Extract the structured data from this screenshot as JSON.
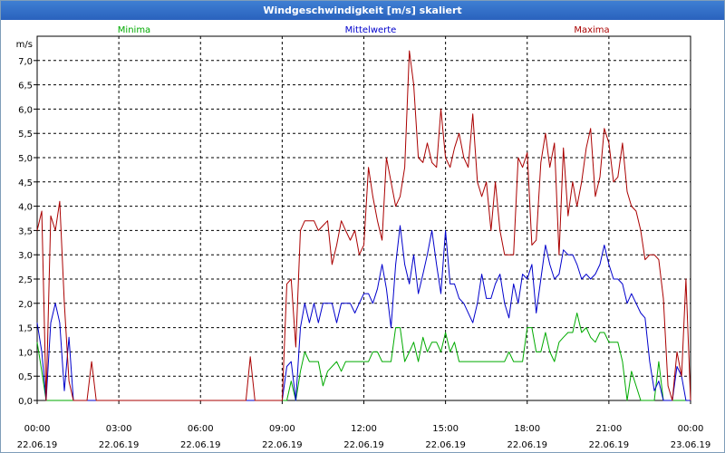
{
  "window": {
    "title": "Windgeschwindigkeit [m/s] skaliert"
  },
  "chart_data": {
    "type": "line",
    "title": "Windgeschwindigkeit [m/s] skaliert",
    "ylabel": "m/s",
    "ylim": [
      0,
      7.5
    ],
    "xlim": [
      0,
      24
    ],
    "grid": true,
    "legend_position": "top",
    "y_ticks": [
      "0,0",
      "0,5",
      "1,0",
      "1,5",
      "2,0",
      "2,5",
      "3,0",
      "3,5",
      "4,0",
      "4,5",
      "5,0",
      "5,5",
      "6,0",
      "6,5",
      "7,0"
    ],
    "x_ticks": [
      {
        "time": "00:00",
        "date": "22.06.19"
      },
      {
        "time": "03:00",
        "date": "22.06.19"
      },
      {
        "time": "06:00",
        "date": "22.06.19"
      },
      {
        "time": "09:00",
        "date": "22.06.19"
      },
      {
        "time": "12:00",
        "date": "22.06.19"
      },
      {
        "time": "15:00",
        "date": "22.06.19"
      },
      {
        "time": "18:00",
        "date": "22.06.19"
      },
      {
        "time": "21:00",
        "date": "22.06.19"
      },
      {
        "time": "00:00",
        "date": "23.06.19"
      }
    ],
    "series": [
      {
        "name": "Minima",
        "color": "#00aa00",
        "points": [
          [
            0,
            1.2
          ],
          [
            0.17,
            0.6
          ],
          [
            0.33,
            0
          ],
          [
            0.5,
            0
          ],
          [
            0.67,
            0
          ],
          [
            0.83,
            0
          ],
          [
            1,
            0
          ],
          [
            1.17,
            0
          ],
          [
            1.33,
            0
          ],
          [
            1.5,
            0
          ],
          [
            2,
            0
          ],
          [
            3,
            0
          ],
          [
            6,
            0
          ],
          [
            8,
            0
          ],
          [
            9,
            0
          ],
          [
            9.17,
            0
          ],
          [
            9.33,
            0.4
          ],
          [
            9.5,
            0
          ],
          [
            9.67,
            0.6
          ],
          [
            9.83,
            1
          ],
          [
            10,
            0.8
          ],
          [
            10.17,
            0.8
          ],
          [
            10.33,
            0.8
          ],
          [
            10.5,
            0.3
          ],
          [
            10.67,
            0.6
          ],
          [
            10.83,
            0.7
          ],
          [
            11,
            0.8
          ],
          [
            11.17,
            0.6
          ],
          [
            11.33,
            0.8
          ],
          [
            11.5,
            0.8
          ],
          [
            11.67,
            0.8
          ],
          [
            11.83,
            0.8
          ],
          [
            12,
            0.8
          ],
          [
            12.17,
            0.8
          ],
          [
            12.33,
            1
          ],
          [
            12.5,
            1
          ],
          [
            12.67,
            0.8
          ],
          [
            12.83,
            0.8
          ],
          [
            13,
            0.8
          ],
          [
            13.17,
            1.5
          ],
          [
            13.33,
            1.5
          ],
          [
            13.5,
            0.8
          ],
          [
            13.67,
            1
          ],
          [
            13.83,
            1.2
          ],
          [
            14,
            0.8
          ],
          [
            14.17,
            1.3
          ],
          [
            14.33,
            1
          ],
          [
            14.5,
            1.2
          ],
          [
            14.67,
            1.2
          ],
          [
            14.83,
            1
          ],
          [
            15,
            1.4
          ],
          [
            15.17,
            1
          ],
          [
            15.33,
            1.2
          ],
          [
            15.5,
            0.8
          ],
          [
            15.67,
            0.8
          ],
          [
            16,
            0.8
          ],
          [
            16.5,
            0.8
          ],
          [
            17,
            0.8
          ],
          [
            17.17,
            0.8
          ],
          [
            17.33,
            1
          ],
          [
            17.5,
            0.8
          ],
          [
            17.67,
            0.8
          ],
          [
            17.83,
            0.8
          ],
          [
            18,
            1.5
          ],
          [
            18.17,
            1.5
          ],
          [
            18.33,
            1
          ],
          [
            18.5,
            1
          ],
          [
            18.67,
            1.4
          ],
          [
            18.83,
            1
          ],
          [
            19,
            0.8
          ],
          [
            19.17,
            1.2
          ],
          [
            19.33,
            1.3
          ],
          [
            19.5,
            1.4
          ],
          [
            19.67,
            1.4
          ],
          [
            19.83,
            1.8
          ],
          [
            20,
            1.4
          ],
          [
            20.17,
            1.5
          ],
          [
            20.33,
            1.3
          ],
          [
            20.5,
            1.2
          ],
          [
            20.67,
            1.4
          ],
          [
            20.83,
            1.4
          ],
          [
            21,
            1.2
          ],
          [
            21.17,
            1.2
          ],
          [
            21.33,
            1.2
          ],
          [
            21.5,
            0.8
          ],
          [
            21.67,
            0
          ],
          [
            21.83,
            0.6
          ],
          [
            22,
            0.3
          ],
          [
            22.17,
            0
          ],
          [
            22.33,
            0
          ],
          [
            22.5,
            0
          ],
          [
            22.67,
            0
          ],
          [
            22.83,
            0.8
          ],
          [
            23,
            0
          ],
          [
            23.17,
            0
          ],
          [
            23.33,
            0
          ],
          [
            23.5,
            0
          ],
          [
            23.67,
            0
          ],
          [
            23.83,
            0
          ],
          [
            24,
            0
          ]
        ]
      },
      {
        "name": "Mittelwerte",
        "color": "#0000cc",
        "points": [
          [
            0,
            1.6
          ],
          [
            0.17,
            1
          ],
          [
            0.33,
            0
          ],
          [
            0.5,
            1.6
          ],
          [
            0.67,
            2
          ],
          [
            0.83,
            1.6
          ],
          [
            1,
            0.2
          ],
          [
            1.17,
            1.3
          ],
          [
            1.33,
            0
          ],
          [
            1.5,
            0
          ],
          [
            2,
            0
          ],
          [
            3,
            0
          ],
          [
            6,
            0
          ],
          [
            8,
            0
          ],
          [
            9,
            0
          ],
          [
            9.17,
            0.7
          ],
          [
            9.33,
            0.8
          ],
          [
            9.5,
            0
          ],
          [
            9.67,
            1.5
          ],
          [
            9.83,
            2
          ],
          [
            10,
            1.6
          ],
          [
            10.17,
            2
          ],
          [
            10.33,
            1.6
          ],
          [
            10.5,
            2
          ],
          [
            10.67,
            2
          ],
          [
            10.83,
            2
          ],
          [
            11,
            1.6
          ],
          [
            11.17,
            2
          ],
          [
            11.33,
            2
          ],
          [
            11.5,
            2
          ],
          [
            11.67,
            1.8
          ],
          [
            11.83,
            2
          ],
          [
            12,
            2.2
          ],
          [
            12.17,
            2.2
          ],
          [
            12.33,
            2
          ],
          [
            12.5,
            2.3
          ],
          [
            12.67,
            2.8
          ],
          [
            12.83,
            2.3
          ],
          [
            13,
            1.5
          ],
          [
            13.17,
            2.8
          ],
          [
            13.33,
            3.6
          ],
          [
            13.5,
            2.8
          ],
          [
            13.67,
            2.4
          ],
          [
            13.83,
            3
          ],
          [
            14,
            2.2
          ],
          [
            14.17,
            2.6
          ],
          [
            14.33,
            3
          ],
          [
            14.5,
            3.5
          ],
          [
            14.67,
            2.8
          ],
          [
            14.83,
            2.2
          ],
          [
            15,
            3.5
          ],
          [
            15.17,
            2.4
          ],
          [
            15.33,
            2.4
          ],
          [
            15.5,
            2.1
          ],
          [
            15.67,
            2
          ],
          [
            16,
            1.6
          ],
          [
            16.17,
            2
          ],
          [
            16.33,
            2.6
          ],
          [
            16.5,
            2.1
          ],
          [
            16.67,
            2.1
          ],
          [
            16.83,
            2.4
          ],
          [
            17,
            2.6
          ],
          [
            17.17,
            2
          ],
          [
            17.33,
            1.7
          ],
          [
            17.5,
            2.4
          ],
          [
            17.67,
            2
          ],
          [
            17.83,
            2.6
          ],
          [
            18,
            2.5
          ],
          [
            18.17,
            2.8
          ],
          [
            18.33,
            1.8
          ],
          [
            18.5,
            2.5
          ],
          [
            18.67,
            3.2
          ],
          [
            18.83,
            2.8
          ],
          [
            19,
            2.5
          ],
          [
            19.17,
            2.6
          ],
          [
            19.33,
            3.1
          ],
          [
            19.5,
            3
          ],
          [
            19.67,
            3
          ],
          [
            19.83,
            2.8
          ],
          [
            20,
            2.5
          ],
          [
            20.17,
            2.6
          ],
          [
            20.33,
            2.5
          ],
          [
            20.5,
            2.6
          ],
          [
            20.67,
            2.8
          ],
          [
            20.83,
            3.2
          ],
          [
            21,
            2.8
          ],
          [
            21.17,
            2.5
          ],
          [
            21.33,
            2.5
          ],
          [
            21.5,
            2.4
          ],
          [
            21.67,
            2
          ],
          [
            21.83,
            2.2
          ],
          [
            22,
            2
          ],
          [
            22.17,
            1.8
          ],
          [
            22.33,
            1.7
          ],
          [
            22.5,
            0.8
          ],
          [
            22.67,
            0.2
          ],
          [
            22.83,
            0.4
          ],
          [
            23,
            0
          ],
          [
            23.17,
            0
          ],
          [
            23.33,
            0
          ],
          [
            23.5,
            0.7
          ],
          [
            23.67,
            0.5
          ],
          [
            23.83,
            0
          ],
          [
            24,
            0
          ]
        ]
      },
      {
        "name": "Maxima",
        "color": "#aa0000",
        "points": [
          [
            0,
            3.5
          ],
          [
            0.17,
            3.9
          ],
          [
            0.33,
            0
          ],
          [
            0.5,
            3.8
          ],
          [
            0.67,
            3.5
          ],
          [
            0.83,
            4.1
          ],
          [
            1,
            2
          ],
          [
            1.17,
            0.4
          ],
          [
            1.33,
            0
          ],
          [
            1.5,
            0
          ],
          [
            1.83,
            0
          ],
          [
            2,
            0.8
          ],
          [
            2.17,
            0
          ],
          [
            3,
            0
          ],
          [
            6,
            0
          ],
          [
            7.67,
            0
          ],
          [
            7.83,
            0.9
          ],
          [
            8,
            0
          ],
          [
            9,
            0
          ],
          [
            9.17,
            2.4
          ],
          [
            9.33,
            2.5
          ],
          [
            9.5,
            1.1
          ],
          [
            9.67,
            3.5
          ],
          [
            9.83,
            3.7
          ],
          [
            10,
            3.7
          ],
          [
            10.17,
            3.7
          ],
          [
            10.33,
            3.5
          ],
          [
            10.5,
            3.6
          ],
          [
            10.67,
            3.7
          ],
          [
            10.83,
            2.8
          ],
          [
            11,
            3.2
          ],
          [
            11.17,
            3.7
          ],
          [
            11.33,
            3.5
          ],
          [
            11.5,
            3.3
          ],
          [
            11.67,
            3.5
          ],
          [
            11.83,
            3
          ],
          [
            12,
            3.2
          ],
          [
            12.17,
            4.8
          ],
          [
            12.33,
            4.2
          ],
          [
            12.5,
            3.7
          ],
          [
            12.67,
            3.3
          ],
          [
            12.83,
            5
          ],
          [
            13,
            4.5
          ],
          [
            13.17,
            4
          ],
          [
            13.33,
            4.2
          ],
          [
            13.5,
            4.8
          ],
          [
            13.67,
            7.2
          ],
          [
            13.83,
            6.5
          ],
          [
            14,
            5
          ],
          [
            14.17,
            4.9
          ],
          [
            14.33,
            5.3
          ],
          [
            14.5,
            4.9
          ],
          [
            14.67,
            4.8
          ],
          [
            14.83,
            6
          ],
          [
            15,
            5
          ],
          [
            15.17,
            4.8
          ],
          [
            15.33,
            5.2
          ],
          [
            15.5,
            5.5
          ],
          [
            15.67,
            5
          ],
          [
            15.83,
            4.8
          ],
          [
            16,
            5.9
          ],
          [
            16.17,
            4.5
          ],
          [
            16.33,
            4.2
          ],
          [
            16.5,
            4.5
          ],
          [
            16.67,
            3.5
          ],
          [
            16.83,
            4.5
          ],
          [
            17,
            3.5
          ],
          [
            17.17,
            3
          ],
          [
            17.33,
            3
          ],
          [
            17.5,
            3
          ],
          [
            17.67,
            5
          ],
          [
            17.83,
            4.8
          ],
          [
            18,
            5.1
          ],
          [
            18.17,
            3.2
          ],
          [
            18.33,
            3.3
          ],
          [
            18.5,
            4.9
          ],
          [
            18.67,
            5.5
          ],
          [
            18.83,
            4.8
          ],
          [
            19,
            5.3
          ],
          [
            19.17,
            3
          ],
          [
            19.33,
            5.2
          ],
          [
            19.5,
            3.8
          ],
          [
            19.67,
            4.5
          ],
          [
            19.83,
            4
          ],
          [
            20,
            4.5
          ],
          [
            20.17,
            5.2
          ],
          [
            20.33,
            5.6
          ],
          [
            20.5,
            4.2
          ],
          [
            20.67,
            4.6
          ],
          [
            20.83,
            5.6
          ],
          [
            21,
            5.3
          ],
          [
            21.17,
            4.5
          ],
          [
            21.33,
            4.6
          ],
          [
            21.5,
            5.3
          ],
          [
            21.67,
            4.3
          ],
          [
            21.83,
            4
          ],
          [
            22,
            3.9
          ],
          [
            22.17,
            3.5
          ],
          [
            22.33,
            2.9
          ],
          [
            22.5,
            3
          ],
          [
            22.67,
            3
          ],
          [
            22.83,
            2.9
          ],
          [
            23,
            2.1
          ],
          [
            23.17,
            0.3
          ],
          [
            23.33,
            0
          ],
          [
            23.5,
            1
          ],
          [
            23.67,
            0.5
          ],
          [
            23.83,
            2.5
          ],
          [
            24,
            0
          ]
        ]
      }
    ]
  }
}
